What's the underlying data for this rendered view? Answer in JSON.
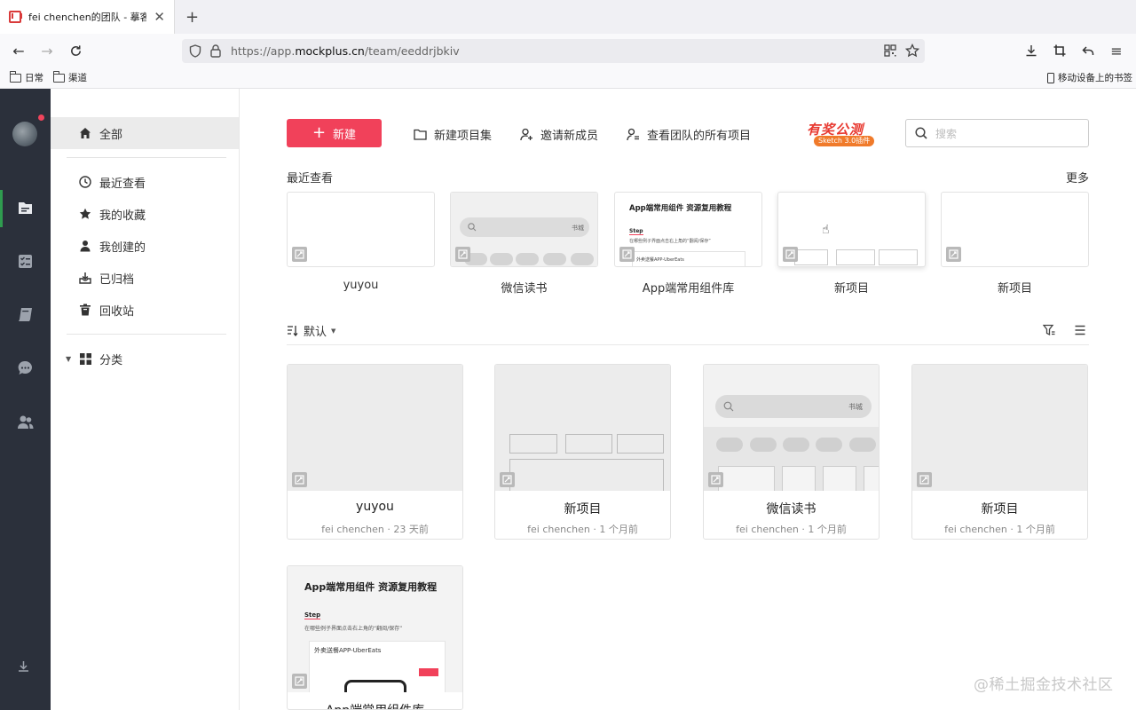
{
  "browser": {
    "tab_title": "fei chenchen的团队 - 摹客",
    "url_prefix": "https://app.",
    "url_domain": "mockplus.cn",
    "url_path": "/team/eeddrjbkiv",
    "bookmarks": [
      "日常",
      "渠道"
    ],
    "mobile_bookmarks": "移动设备上的书签"
  },
  "sidebar": {
    "all": "全部",
    "items": [
      "最近查看",
      "我的收藏",
      "我创建的",
      "已归档",
      "回收站"
    ],
    "category": "分类"
  },
  "toolbar": {
    "new_label": "新建",
    "new_collection": "新建项目集",
    "invite": "邀请新成员",
    "view_all": "查看团队的所有项目",
    "promo_title": "有奖公测",
    "promo_sub": "Sketch 3.0插件",
    "search_placeholder": "搜索"
  },
  "recent": {
    "title": "最近查看",
    "more": "更多",
    "items": [
      "yuyou",
      "微信读书",
      "App端常用组件库",
      "新项目",
      "新项目"
    ],
    "thumb_texts": {
      "search_tag": "书城",
      "doc_title": "App端常用组件 资源复用教程",
      "doc_step": "Step",
      "doc_line": "在哪些例子界面点击右上角的“翻阅/保存”",
      "doc_card": "外卖送餐APP-UberEats"
    }
  },
  "sort": {
    "label": "默认"
  },
  "projects": [
    {
      "name": "yuyou",
      "meta": "fei chenchen · 23 天前"
    },
    {
      "name": "新项目",
      "meta": "fei chenchen · 1 个月前"
    },
    {
      "name": "微信读书",
      "meta": "fei chenchen · 1 个月前"
    },
    {
      "name": "新项目",
      "meta": "fei chenchen · 1 个月前"
    },
    {
      "name": "App端常用组件库",
      "meta": ""
    }
  ],
  "watermark": "@稀土掘金技术社区"
}
